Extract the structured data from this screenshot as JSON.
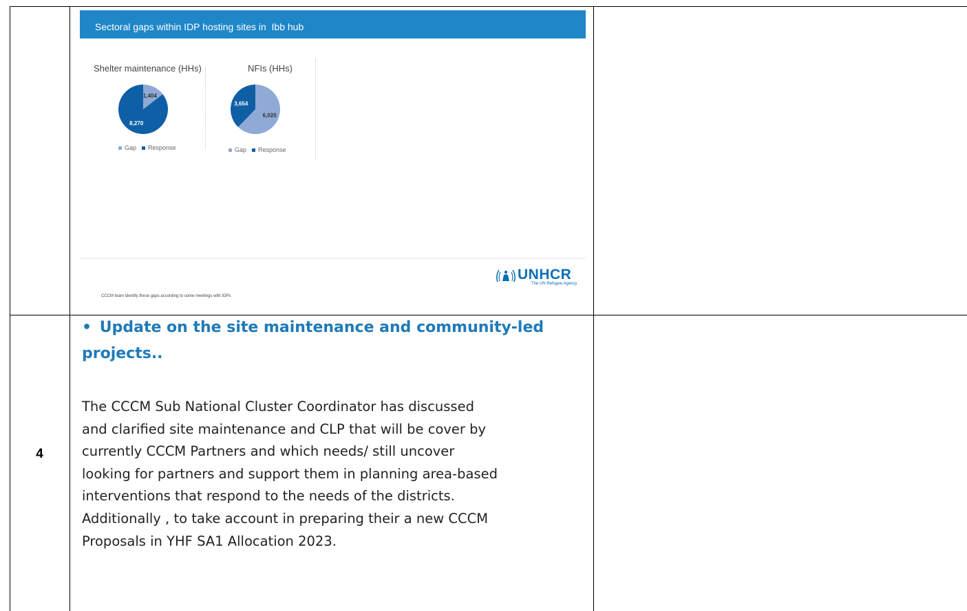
{
  "table": {
    "row_number": "4"
  },
  "slide": {
    "title": "Sectoral gaps within IDP hosting sites in  Ibb hub",
    "footnote": "CCCM team identify these gaps according to some meetings with IDPs",
    "logo": {
      "name": "UNHCR",
      "subtitle": "The UN Refugee Agency",
      "color": "#0a6eb6"
    }
  },
  "chart_data": [
    {
      "type": "pie",
      "title": "Shelter maintenance (HHs)",
      "categories": [
        "Gap",
        "Response"
      ],
      "values": [
        1404,
        8270
      ],
      "labels": [
        "1,404",
        "8,270"
      ],
      "colors": [
        "#8faad6",
        "#0f5fa6"
      ],
      "legend": "bottom"
    },
    {
      "type": "pie",
      "title": "NFIs (HHs)",
      "categories": [
        "Gap",
        "Response"
      ],
      "values": [
        6020,
        3654
      ],
      "labels": [
        "6,020",
        "3,654"
      ],
      "colors": [
        "#8faad6",
        "#0f5fa6"
      ],
      "legend": "bottom"
    }
  ],
  "section": {
    "bullet": "•",
    "heading_line1": "Update on the site maintenance and community-led",
    "heading_line2": "projects..",
    "body_lines": [
      "The CCCM Sub National Cluster Coordinator has discussed",
      "and clarified site maintenance and CLP that will be cover by",
      "currently CCCM Partners and which needs/ still uncover",
      "looking for partners and support them in planning area-based",
      "interventions that respond to the needs of the districts.",
      "Additionally , to take account in preparing  their a new CCCM",
      "Proposals  in YHF SA1 Allocation 2023."
    ]
  }
}
